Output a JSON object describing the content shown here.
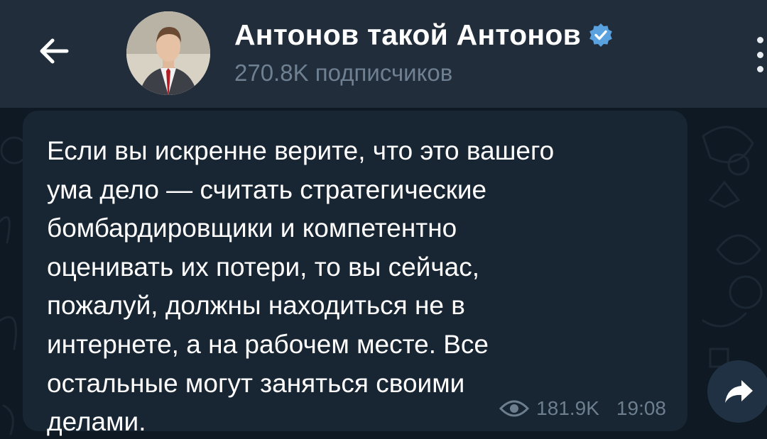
{
  "header": {
    "channel_title": "Антонов такой Антонов",
    "subscribers": "270.8K подписчиков",
    "back_icon": "arrow-left-icon",
    "menu_icon": "more-vertical-icon",
    "verified_icon": "verified-badge-icon"
  },
  "message": {
    "text": "Если вы искренне верите, что это вашего\nума дело — считать стратегические\nбомбардировщики и компетентно\nоценивать их потери, то вы сейчас,\nпожалуй, должны находиться не в\nинтернете, а на рабочем месте. Все\nостальные могут заняться своими\nделами.",
    "views": "181.9K",
    "time": "19:08"
  },
  "colors": {
    "header_bg": "#212d3b",
    "chat_bg": "#0f1923",
    "bubble_bg": "#182533",
    "accent": "#5aa1e0",
    "meta_text": "#6d7f8f"
  }
}
